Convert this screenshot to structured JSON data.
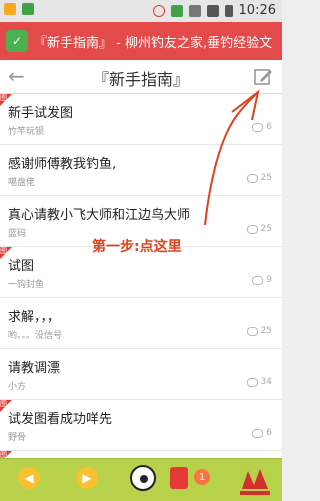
{
  "statusbar": {
    "time": "10:26"
  },
  "notification": {
    "text": "『新手指南』 - 柳州钓友之家,垂钓经验文"
  },
  "header": {
    "back": "←",
    "title": "『新手指南』"
  },
  "threads": [
    {
      "title": "新手试发图",
      "author": "竹竿玩钡",
      "count": "6",
      "flag": "图"
    },
    {
      "title": "感谢师傅教我钓鱼,",
      "author": "噶盘佬",
      "count": "25",
      "flag": ""
    },
    {
      "title": "真心请教小飞大师和江边鸟大师",
      "author": "蓝码",
      "count": "25",
      "flag": ""
    },
    {
      "title": "试图",
      "author": "一钩封鱼",
      "count": "9",
      "flag": "图"
    },
    {
      "title": "求解，，，",
      "author": "哟。。。没信号",
      "count": "25",
      "flag": ""
    },
    {
      "title": "请教调漂",
      "author": "小方",
      "count": "34",
      "flag": ""
    },
    {
      "title": "试发图看成功咩先",
      "author": "野骨",
      "count": "6",
      "flag": "图"
    },
    {
      "title": "",
      "author": "",
      "count": "",
      "flag": "图"
    }
  ],
  "annotation": {
    "text": "第一步:点这里"
  },
  "bottombar": {
    "page_badge": "1"
  },
  "colors": {
    "notif_bg": "#e34b4b",
    "bottom_bg": "#b7d14a",
    "annotation": "#e0411f"
  }
}
